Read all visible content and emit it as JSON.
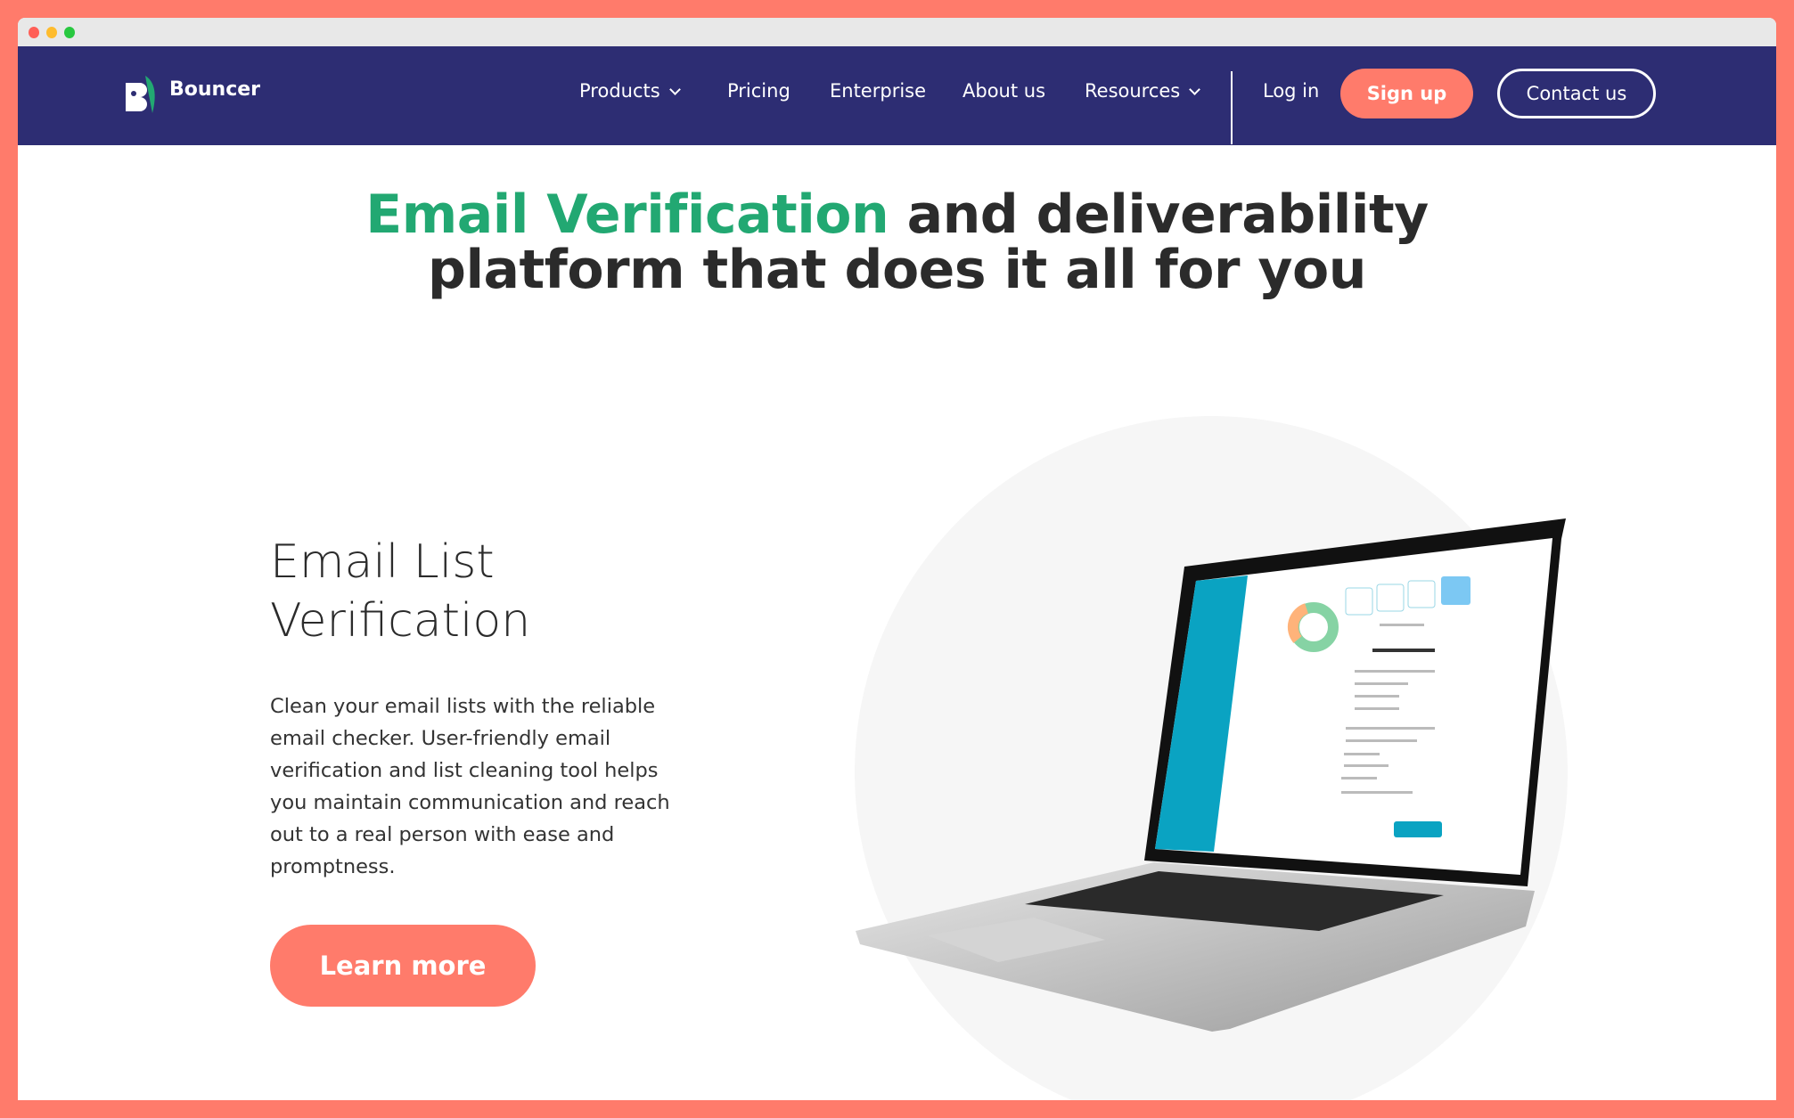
{
  "window": {
    "controls": [
      "close",
      "minimize",
      "maximize"
    ],
    "colors": {
      "close": "#FF5F57",
      "minimize": "#FEBC2E",
      "maximize": "#28C840"
    }
  },
  "nav": {
    "brand": "Bouncer",
    "items": [
      {
        "label": "Products",
        "has_dropdown": true
      },
      {
        "label": "Pricing"
      },
      {
        "label": "Enterprise"
      },
      {
        "label": "About us"
      },
      {
        "label": "Resources",
        "has_dropdown": true
      }
    ],
    "login": "Log in",
    "signup": "Sign up",
    "contact": "Contact us"
  },
  "hero": {
    "title_accent": "Email Verification",
    "title_rest_line1": " and deliverability",
    "title_line2": "platform that does it all for you"
  },
  "feature": {
    "title": "Email List Verification",
    "description": "Clean your email lists with the reliable email checker. User-friendly email verification and list cleaning tool helps you maintain communication and reach out to a real person with ease and promptness.",
    "cta": "Learn more"
  },
  "colors": {
    "frame": "#FF7B6B",
    "nav_bg": "#2D2D73",
    "accent_green": "#22A872",
    "cta": "#FF7B6B",
    "app_sidebar": "#0AA3C2"
  }
}
